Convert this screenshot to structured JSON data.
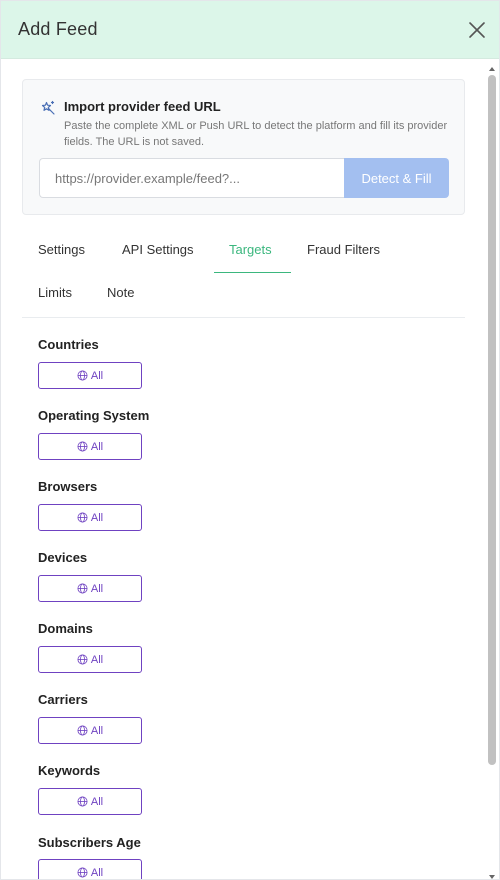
{
  "header": {
    "title": "Add Feed",
    "close_icon": "close-icon"
  },
  "import": {
    "icon": "magic-wand-icon",
    "title": "Import provider feed URL",
    "description": "Paste the complete XML or Push URL to detect the platform and fill its provider fields. The URL is not saved.",
    "url_value": "",
    "url_placeholder": "https://provider.example/feed?...",
    "detect_label": "Detect & Fill"
  },
  "tabs": [
    {
      "label": "Settings",
      "active": false
    },
    {
      "label": "API Settings",
      "active": false
    },
    {
      "label": "Targets",
      "active": true
    },
    {
      "label": "Fraud Filters",
      "active": false
    },
    {
      "label": "Limits",
      "active": false
    },
    {
      "label": "Note",
      "active": false
    }
  ],
  "targets": [
    {
      "label": "Countries",
      "button_label": "All"
    },
    {
      "label": "Operating System",
      "button_label": "All"
    },
    {
      "label": "Browsers",
      "button_label": "All"
    },
    {
      "label": "Devices",
      "button_label": "All"
    },
    {
      "label": "Domains",
      "button_label": "All"
    },
    {
      "label": "Carriers",
      "button_label": "All"
    },
    {
      "label": "Keywords",
      "button_label": "All"
    },
    {
      "label": "Subscribers Age",
      "button_label": "All"
    }
  ],
  "colors": {
    "header_bg": "#dcf6e9",
    "accent_green": "#3bb77e",
    "accent_purple": "#6f42c1",
    "detect_button_bg": "#a3bff0"
  }
}
